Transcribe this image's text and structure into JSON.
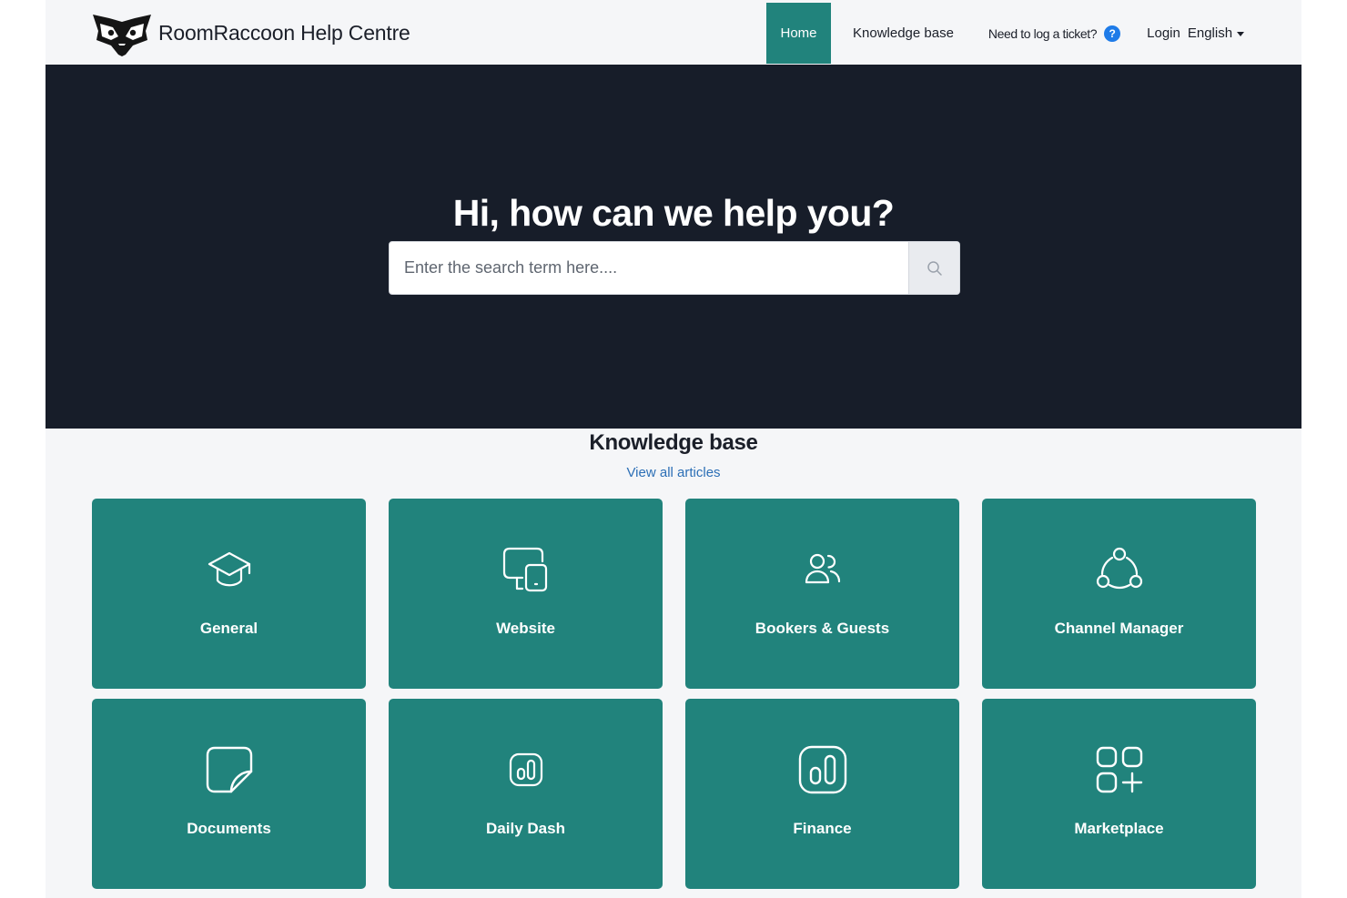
{
  "header": {
    "brand": "RoomRaccoon Help Centre",
    "nav": {
      "home": "Home",
      "knowledge_base": "Knowledge base",
      "ticket": "Need to log a ticket?",
      "ticket_badge": "?",
      "login": "Login",
      "language": "English"
    }
  },
  "hero": {
    "title": "Hi, how can we help you?",
    "search_placeholder": "Enter the search term here....",
    "search_value": ""
  },
  "knowledge_base": {
    "title": "Knowledge base",
    "view_all": "View all articles",
    "categories": [
      {
        "label": "General",
        "icon": "graduation-cap-icon"
      },
      {
        "label": "Website",
        "icon": "devices-icon"
      },
      {
        "label": "Bookers & Guests",
        "icon": "users-icon"
      },
      {
        "label": "Channel Manager",
        "icon": "channels-icon"
      },
      {
        "label": "Documents",
        "icon": "document-icon"
      },
      {
        "label": "Daily Dash",
        "icon": "chart-bars-icon"
      },
      {
        "label": "Finance",
        "icon": "chart-bars-icon"
      },
      {
        "label": "Marketplace",
        "icon": "apps-add-icon"
      }
    ]
  },
  "colors": {
    "accent": "#21837c",
    "hero_background": "#171d29",
    "page_background": "#f5f6f8",
    "link": "#2c6fb6",
    "help_badge": "#1e7be8"
  }
}
